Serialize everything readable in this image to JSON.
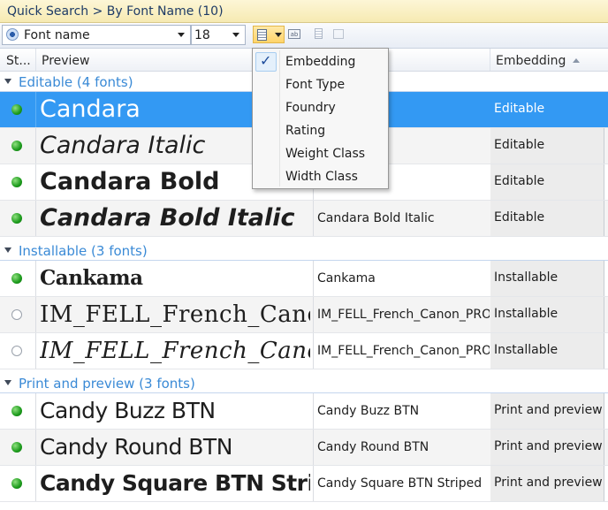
{
  "title": "Quick Search > By Font Name (10)",
  "toolbar": {
    "filter_field": "Font name",
    "size_value": "18",
    "ab_label": "ab"
  },
  "columns": {
    "status": "St...",
    "preview": "Preview",
    "embedding": "Embedding"
  },
  "column_menu": {
    "items": [
      {
        "label": "Embedding",
        "checked": true
      },
      {
        "label": "Font Type",
        "checked": false
      },
      {
        "label": "Foundry",
        "checked": false
      },
      {
        "label": "Rating",
        "checked": false
      },
      {
        "label": "Weight Class",
        "checked": false
      },
      {
        "label": "Width Class",
        "checked": false
      }
    ],
    "check_glyph": "✓"
  },
  "groups": [
    {
      "label": "Editable (4 fonts)",
      "rows": [
        {
          "preview": "Candara",
          "name": "",
          "embedding": "Editable",
          "active": true
        },
        {
          "preview": "Candara Italic",
          "name": "ic",
          "embedding": "Editable",
          "active": true
        },
        {
          "preview": "Candara Bold",
          "name": "d",
          "embedding": "Editable",
          "active": true
        },
        {
          "preview": "Candara Bold Italic",
          "name": "Candara Bold Italic",
          "embedding": "Editable",
          "active": true
        }
      ]
    },
    {
      "label": "Installable (3 fonts)",
      "rows": [
        {
          "preview": "Cankama",
          "name": "Cankama",
          "embedding": "Installable",
          "active": true
        },
        {
          "preview": "IM_FELL_French_Canon",
          "name": "IM_FELL_French_Canon_PRO_R",
          "embedding": "Installable",
          "active": false
        },
        {
          "preview": "IM_FELL_French_Canon",
          "name": "IM_FELL_French_Canon_PRO_It",
          "embedding": "Installable",
          "active": false
        }
      ]
    },
    {
      "label": "Print and preview (3 fonts)",
      "rows": [
        {
          "preview": "Candy Buzz BTN",
          "name": "Candy Buzz BTN",
          "embedding": "Print and preview",
          "active": true
        },
        {
          "preview": "Candy Round BTN",
          "name": "Candy Round BTN",
          "embedding": "Print and preview",
          "active": true
        },
        {
          "preview": "Candy Square BTN Striped",
          "name": "Candy Square BTN Striped",
          "embedding": "Print and preview",
          "active": true
        }
      ]
    }
  ],
  "colors": {
    "selection": "#3399f3",
    "group_label": "#3a8ad6",
    "title_bar": "#f6eab2"
  }
}
